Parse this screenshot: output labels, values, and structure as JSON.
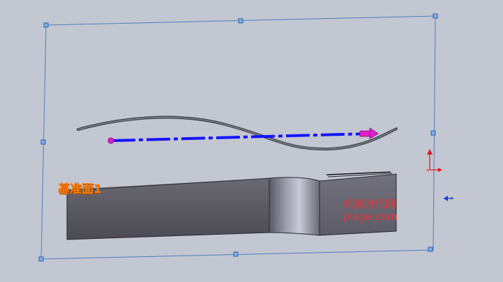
{
  "viewport": {
    "background_color": "#c3c7d1",
    "plane": {
      "label": "基准面1",
      "border_color": "#4a7fc1",
      "handle_color": "#3a78c9"
    },
    "sketch": {
      "guide_curve_color": "#4a4d57",
      "path_line_color": "#1414ff",
      "start_point_color": "#e020c8",
      "direction_arrow_color": "#e020c8"
    },
    "part": {
      "front_face_color": "#58565e",
      "side_face_color": "#6a6974"
    },
    "triad": {
      "y_axis_color": "#e01818",
      "view_icon_color": "#1a3cd0"
    }
  },
  "watermark": {
    "line1": "机械时代网",
    "line2": "jxage.com",
    "color": "#e8343a"
  }
}
